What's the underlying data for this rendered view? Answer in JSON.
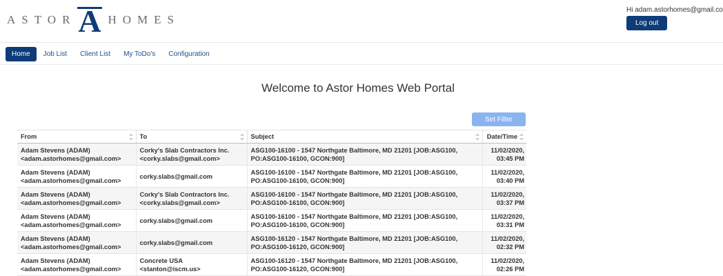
{
  "brand": {
    "left_word": "ASTOR",
    "right_word": "HOMES",
    "mark_letter": "A",
    "mark_color": "#0d3c78"
  },
  "user": {
    "greeting": "Hi adam.astorhomes@gmail.com",
    "logout_label": "Log out"
  },
  "nav": [
    {
      "label": "Home",
      "active": true
    },
    {
      "label": "Job List"
    },
    {
      "label": "Client List"
    },
    {
      "label": "My ToDo's"
    },
    {
      "label": "Configuration"
    }
  ],
  "page_title": "Welcome to Astor Homes Web Portal",
  "filter_label": "Set Filter",
  "table": {
    "headers": [
      "From",
      "To",
      "Subject",
      "Date/Time"
    ],
    "rows": [
      {
        "from": [
          "Adam Stevens (ADAM)",
          "<adam.astorhomes@gmail.com>"
        ],
        "to": [
          "Corky's Slab Contractors Inc.",
          "<corky.slabs@gmail.com>"
        ],
        "subject": [
          "ASG100-16100 - 1547 Northgate Baltimore, MD 21201 [JOB:ASG100,",
          "PO:ASG100-16100, GCON:900]"
        ],
        "date": [
          "11/02/2020,",
          "03:45 PM"
        ]
      },
      {
        "from": [
          "Adam Stevens (ADAM)",
          "<adam.astorhomes@gmail.com>"
        ],
        "to": [
          "corky.slabs@gmail.com",
          ""
        ],
        "subject": [
          "ASG100-16100 - 1547 Northgate Baltimore, MD 21201 [JOB:ASG100,",
          "PO:ASG100-16100, GCON:900]"
        ],
        "date": [
          "11/02/2020,",
          "03:40 PM"
        ]
      },
      {
        "from": [
          "Adam Stevens (ADAM)",
          "<adam.astorhomes@gmail.com>"
        ],
        "to": [
          "Corky's Slab Contractors Inc.",
          "<corky.slabs@gmail.com>"
        ],
        "subject": [
          "ASG100-16100 - 1547 Northgate Baltimore, MD 21201 [JOB:ASG100,",
          "PO:ASG100-16100, GCON:900]"
        ],
        "date": [
          "11/02/2020,",
          "03:37 PM"
        ]
      },
      {
        "from": [
          "Adam Stevens (ADAM)",
          "<adam.astorhomes@gmail.com>"
        ],
        "to": [
          "corky.slabs@gmail.com",
          ""
        ],
        "subject": [
          "ASG100-16100 - 1547 Northgate Baltimore, MD 21201 [JOB:ASG100,",
          "PO:ASG100-16100, GCON:900]"
        ],
        "date": [
          "11/02/2020,",
          "03:31 PM"
        ]
      },
      {
        "from": [
          "Adam Stevens (ADAM)",
          "<adam.astorhomes@gmail.com>"
        ],
        "to": [
          "corky.slabs@gmail.com",
          ""
        ],
        "subject": [
          "ASG100-16120 - 1547 Northgate Baltimore, MD 21201 [JOB:ASG100,",
          "PO:ASG100-16120, GCON:900]"
        ],
        "date": [
          "11/02/2020,",
          "02:32 PM"
        ]
      },
      {
        "from": [
          "Adam Stevens (ADAM)",
          "<adam.astorhomes@gmail.com>"
        ],
        "to": [
          "Concrete USA",
          "<stanton@iscm.us>"
        ],
        "subject": [
          "ASG100-16120 - 1547 Northgate Baltimore, MD 21201 [JOB:ASG100,",
          "PO:ASG100-16120, GCON:900]"
        ],
        "date": [
          "11/02/2020,",
          "02:26 PM"
        ]
      }
    ]
  }
}
